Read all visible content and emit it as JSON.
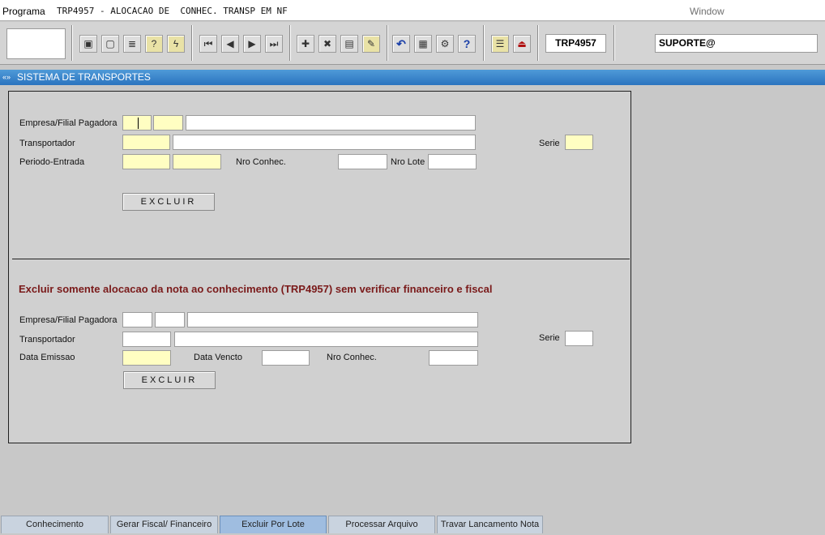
{
  "menubar": {
    "programa": "Programa",
    "title": "TRP4957 - ALOCACAO DE  CONHEC. TRANSP EM NF",
    "window": "Window"
  },
  "toolbar": {
    "program_code": "TRP4957",
    "user": "SUPORTE@",
    "buttons": [
      {
        "name": "save-icon",
        "glyph": "▣"
      },
      {
        "name": "window-icon",
        "glyph": "▢"
      },
      {
        "name": "print-icon",
        "glyph": "≣"
      },
      {
        "name": "help-query-icon",
        "glyph": "?"
      },
      {
        "name": "query-execute-icon",
        "glyph": "ϟ"
      },
      {
        "name": "first-record-icon",
        "glyph": "⏮"
      },
      {
        "name": "previous-record-icon",
        "glyph": "◀"
      },
      {
        "name": "next-record-icon",
        "glyph": "▶"
      },
      {
        "name": "last-record-icon",
        "glyph": "⏭"
      },
      {
        "name": "insert-record-icon",
        "glyph": "✚"
      },
      {
        "name": "delete-record-icon",
        "glyph": "✖"
      },
      {
        "name": "list-icon",
        "glyph": "▤"
      },
      {
        "name": "edit-icon",
        "glyph": "✎"
      },
      {
        "name": "undo-icon",
        "glyph": "↶"
      },
      {
        "name": "clipboard-icon",
        "glyph": "▦"
      },
      {
        "name": "tools-icon",
        "glyph": "⚙"
      },
      {
        "name": "help-icon",
        "glyph": "?"
      },
      {
        "name": "menu-icon",
        "glyph": "☰"
      },
      {
        "name": "exit-icon",
        "glyph": "⏏"
      }
    ]
  },
  "section_title": "SISTEMA DE TRANSPORTES",
  "form1": {
    "empresa_label": "Empresa/Filial Pagadora",
    "transportador_label": "Transportador",
    "periodo_label": "Periodo-Entrada",
    "nro_conhec_label": "Nro Conhec.",
    "nro_lote_label": "Nro Lote",
    "serie_label": "Serie",
    "excluir": "EXCLUIR"
  },
  "form2": {
    "warning": "Excluir somente alocacao da nota ao conhecimento (TRP4957) sem  verificar financeiro e fiscal",
    "empresa_label": "Empresa/Filial Pagadora",
    "transportador_label": "Transportador",
    "data_emissao_label": "Data Emissao",
    "data_vencto_label": "Data Vencto",
    "nro_conhec_label": "Nro Conhec.",
    "serie_label": "Serie",
    "excluir": "EXCLUIR"
  },
  "tabs": [
    "Conhecimento",
    "Gerar Fiscal/ Financeiro",
    "Excluir Por Lote",
    "Processar Arquivo",
    "Travar Lancamento Nota"
  ],
  "active_tab": "Excluir Por Lote"
}
